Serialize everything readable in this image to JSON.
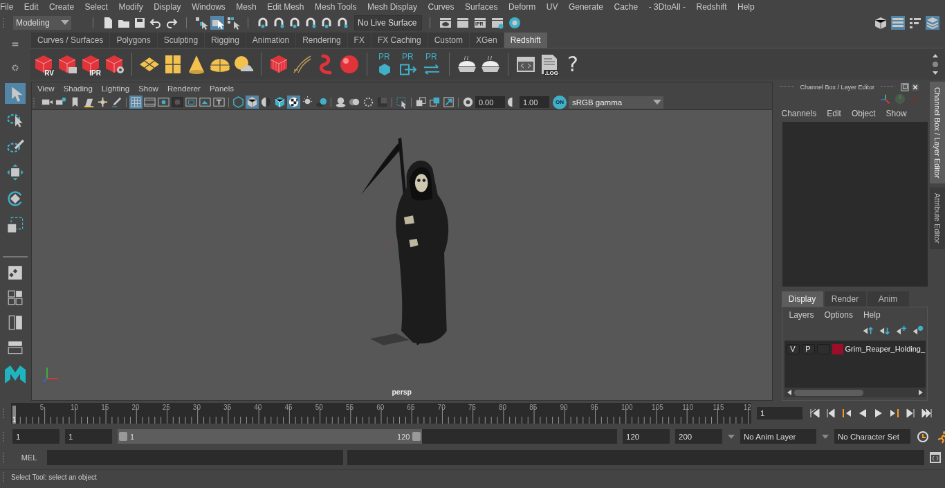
{
  "menu": [
    "File",
    "Edit",
    "Create",
    "Select",
    "Modify",
    "Display",
    "Windows",
    "Mesh",
    "Edit Mesh",
    "Mesh Tools",
    "Mesh Display",
    "Curves",
    "Surfaces",
    "Deform",
    "UV",
    "Generate",
    "Cache",
    "- 3DtoAll -",
    "Redshift",
    "Help"
  ],
  "workspace": "Modeling",
  "status_tools": [
    {
      "kind": "select-hierarchy",
      "selected": false
    },
    {
      "kind": "select-object",
      "selected": true
    },
    {
      "kind": "select-component",
      "selected": false
    }
  ],
  "live_surface": "No Live Surface",
  "render_tools": [
    {
      "kind": "clapper-eye"
    },
    {
      "kind": "clapper"
    },
    {
      "kind": "clapper",
      "label": "IPR"
    },
    {
      "kind": "clapper-gear"
    },
    {
      "kind": "ring"
    }
  ],
  "workspace_icons": [
    {
      "kind": "toolkit",
      "selected": false
    },
    {
      "kind": "attributes",
      "selected": true
    },
    {
      "kind": "tool-settings",
      "selected": false
    },
    {
      "kind": "channels",
      "selected": true
    }
  ],
  "shelf_tabs": [
    {
      "label": "Curves / Surfaces",
      "selected": false
    },
    {
      "label": "Polygons",
      "selected": false
    },
    {
      "label": "Sculpting",
      "selected": false
    },
    {
      "label": "Rigging",
      "selected": false
    },
    {
      "label": "Animation",
      "selected": false
    },
    {
      "label": "Rendering",
      "selected": false
    },
    {
      "label": "FX",
      "selected": false
    },
    {
      "label": "FX Caching",
      "selected": false
    },
    {
      "label": "Custom",
      "selected": false
    },
    {
      "label": "XGen",
      "selected": false
    },
    {
      "label": "Redshift",
      "selected": true
    }
  ],
  "shelf": [
    {
      "kind": "red-cube",
      "label": "RV"
    },
    {
      "kind": "red-cube-clapper"
    },
    {
      "kind": "red-cube",
      "label": "IPR"
    },
    {
      "kind": "red-cube-gear"
    },
    {
      "kind": "sep"
    },
    {
      "kind": "plane"
    },
    {
      "kind": "panel-grid"
    },
    {
      "kind": "cone"
    },
    {
      "kind": "dome"
    },
    {
      "kind": "sun"
    },
    {
      "kind": "sep"
    },
    {
      "kind": "cube-grid"
    },
    {
      "kind": "hair"
    },
    {
      "kind": "worm"
    },
    {
      "kind": "sphere"
    },
    {
      "kind": "sep"
    },
    {
      "kind": "pr-cube",
      "label": "PR"
    },
    {
      "kind": "pr-export",
      "label": "PR"
    },
    {
      "kind": "pr-swap",
      "label": "PR"
    },
    {
      "kind": "sep"
    },
    {
      "kind": "pie"
    },
    {
      "kind": "pie"
    },
    {
      "kind": "sep"
    },
    {
      "kind": "code"
    },
    {
      "kind": "log",
      "label": ".LOG"
    },
    {
      "kind": "help",
      "label": "?"
    }
  ],
  "toolbox": [
    {
      "kind": "select",
      "selected": true
    },
    {
      "kind": "lasso",
      "selected": false
    },
    {
      "kind": "paint",
      "selected": false
    },
    {
      "kind": "move",
      "selected": false
    },
    {
      "kind": "rotate",
      "selected": false
    },
    {
      "kind": "scale",
      "selected": false
    }
  ],
  "viewport": {
    "menu": [
      "View",
      "Shading",
      "Lighting",
      "Show",
      "Renderer",
      "Panels"
    ],
    "tools": [
      {
        "kind": "camera",
        "selected": false
      },
      {
        "kind": "camera-attr",
        "selected": false
      },
      {
        "kind": "bookmark",
        "selected": false
      },
      {
        "kind": "image-plane",
        "selected": false
      },
      {
        "kind": "pan",
        "selected": false
      },
      {
        "kind": "pencil",
        "selected": false
      },
      {
        "kind": "sep"
      },
      {
        "kind": "grid",
        "selected": true
      },
      {
        "kind": "film-gate",
        "selected": false
      },
      {
        "kind": "res-gate",
        "selected": false
      },
      {
        "kind": "gate-mask",
        "selected": false
      },
      {
        "kind": "field-chart",
        "selected": false
      },
      {
        "kind": "safe-action",
        "selected": false
      },
      {
        "kind": "safe-title",
        "selected": false
      },
      {
        "kind": "sep"
      },
      {
        "kind": "wire-cube",
        "selected": false
      },
      {
        "kind": "shaded-cube",
        "selected": true
      },
      {
        "kind": "half-shade",
        "selected": false
      },
      {
        "kind": "wire-shaded",
        "selected": false
      },
      {
        "kind": "textured",
        "selected": true
      },
      {
        "kind": "light",
        "selected": false
      },
      {
        "kind": "shadow",
        "selected": false
      },
      {
        "kind": "sep"
      },
      {
        "kind": "ao",
        "selected": false
      },
      {
        "kind": "motion-blur",
        "selected": false
      },
      {
        "kind": "aa",
        "selected": false
      },
      {
        "kind": "dof",
        "selected": false
      },
      {
        "kind": "sep"
      },
      {
        "kind": "isolate",
        "selected": false
      },
      {
        "kind": "sep"
      },
      {
        "kind": "xray",
        "selected": false
      },
      {
        "kind": "xray-joint",
        "selected": false
      },
      {
        "kind": "xray-comp",
        "selected": false
      },
      {
        "kind": "sep"
      }
    ],
    "exposure": "0.00",
    "gamma": "1.00",
    "cm_label": "ON",
    "colorspace": "sRGB gamma",
    "camera": "persp"
  },
  "channel_box": {
    "title": "Channel Box / Layer Editor",
    "menu": [
      "Channels",
      "Edit",
      "Object",
      "Show"
    ]
  },
  "layer_editor": {
    "tabs": [
      {
        "label": "Display",
        "selected": true
      },
      {
        "label": "Render",
        "selected": false
      },
      {
        "label": "Anim",
        "selected": false
      }
    ],
    "menu": [
      "Layers",
      "Options",
      "Help"
    ],
    "layers": [
      {
        "visible": "V",
        "playback": "P",
        "color": "#9b0e2a",
        "name": "Grim_Reaper_Holding_"
      }
    ]
  },
  "side_tabs": [
    {
      "label": "Channel Box / Layer Editor",
      "selected": true
    },
    {
      "label": "Attribute Editor",
      "selected": false
    }
  ],
  "timeline": {
    "start_label": "1",
    "ticks": [
      "5",
      "10",
      "15",
      "20",
      "25",
      "30",
      "35",
      "40",
      "45",
      "50",
      "55",
      "60",
      "65",
      "70",
      "75",
      "80",
      "85",
      "90",
      "95",
      "100",
      "105",
      "110",
      "115",
      "12"
    ],
    "current_frame": "1"
  },
  "range": {
    "start": "1",
    "playback_start": "1",
    "slider_start": "1",
    "slider_end": "120",
    "level": 0.61,
    "playback_end": "120",
    "end": "200",
    "anim_layer": "No Anim Layer",
    "character_set": "No Character Set"
  },
  "command_line": {
    "label": "MEL"
  },
  "status_bar": "Select Tool: select an object"
}
